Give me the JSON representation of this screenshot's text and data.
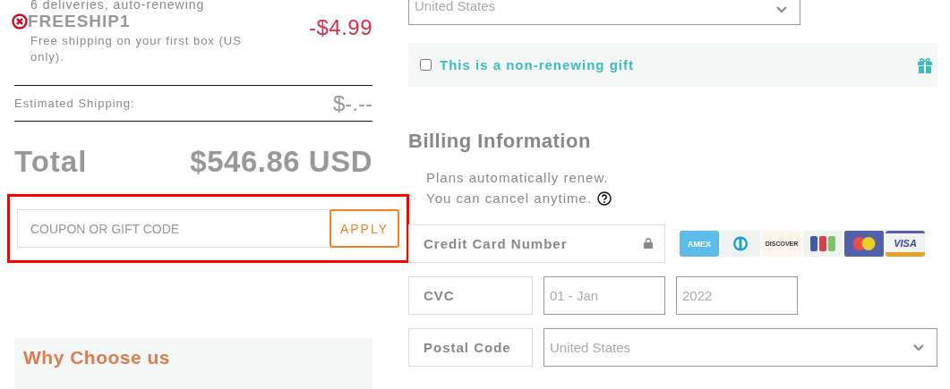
{
  "summary": {
    "plan_note": "6 deliveries, auto-renewing",
    "coupon": {
      "code": "FREESHIP1",
      "description": "Free shipping on your first box (US only).",
      "amount": "-$4.99"
    },
    "shipping": {
      "label": "Estimated Shipping:",
      "value": "$-.--"
    },
    "total": {
      "label": "Total",
      "value": "$546.86 USD"
    },
    "coupon_form": {
      "placeholder": "COUPON OR GIFT CODE",
      "button": "APPLY",
      "highlighted": true
    },
    "why_choose": {
      "title": "Why Choose us"
    }
  },
  "shipping_country": {
    "value": "United States"
  },
  "gift": {
    "label": "This is a non-renewing gift",
    "checked": false
  },
  "billing": {
    "title": "Billing Information",
    "note_lines": [
      "Plans automatically renew.",
      "You can cancel anytime."
    ],
    "card_number": {
      "placeholder": "Credit Card Number"
    },
    "cards": [
      {
        "kind": "amex",
        "label": "AMEX"
      },
      {
        "kind": "diners"
      },
      {
        "kind": "discover",
        "label": "DISCOVER"
      },
      {
        "kind": "jcb"
      },
      {
        "kind": "mastercard"
      },
      {
        "kind": "visa",
        "label": "VISA"
      }
    ],
    "cvc": {
      "placeholder": "CVC"
    },
    "exp_month": {
      "value": "01 - Jan"
    },
    "exp_year": {
      "value": "2022"
    },
    "postal_code": {
      "placeholder": "Postal Code"
    },
    "country": {
      "value": "United States"
    }
  }
}
